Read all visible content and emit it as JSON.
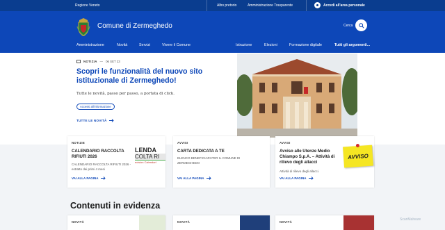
{
  "topbar": {
    "region": "Regione Veneto",
    "links": [
      "Albo pretorio",
      "Amministrazione Trasparente"
    ],
    "login": "Accedi all'area personale"
  },
  "header": {
    "site_name": "Comune di Zermeghedo",
    "search_label": "Cerca"
  },
  "nav": {
    "primary": [
      "Amministrazione",
      "Novità",
      "Servizi",
      "Vivere il Comune"
    ],
    "secondary": [
      "Istruzione",
      "Elezioni",
      "Formazione digitale",
      "Tutti gli argomenti..."
    ]
  },
  "hero": {
    "tag": "NOTIZIA",
    "date": "06 SET 23",
    "title": "Scopri le funzionalità del nuovo sito istituzionale di Zermeghedo!",
    "description": "Tutte le novità, passo per passo, a portata di click.",
    "pill": "Accessi all'informazione",
    "all_news": "TUTTE LE NOVITÀ"
  },
  "cards": [
    {
      "kicker": "NOTIZIE",
      "title": "CALENDARIO RACCOLTA RIFIUTI 2026",
      "body": "CALENDARIO RACCOLTA RIFIUTI 2026 - estratto dei primi 4 mesi",
      "more": "VAI ALLA PAGINA",
      "thumb_lines": [
        "LENDA",
        "COLTA RI",
        "ecision Calendari"
      ]
    },
    {
      "kicker": "AVVISI",
      "title": "CARTA DEDICATA A TE",
      "body": "ELENCO BENEFICIARI PER IL COMUNE DI ZERMEGHEDO",
      "more": "VAI ALLA PAGINA"
    },
    {
      "kicker": "AVVISI",
      "title": "Avviso alle Utenze Medio Chiampo S.p.A. – Attività di rilievo degli allacci",
      "body": "Attività di rilievo degli allacci.",
      "more": "VAI ALLA PAGINA",
      "note": "AVVISO"
    }
  ],
  "featured": {
    "title": "Contenuti in evidenza",
    "kickers": [
      "NOVITÀ",
      "NOVITÀ",
      "NOVITÀ"
    ]
  },
  "watermark": "ScanMalware",
  "colors": {
    "primary": "#0d47b8",
    "topbar": "#0a3d8f",
    "band": "#f2f4f7"
  }
}
